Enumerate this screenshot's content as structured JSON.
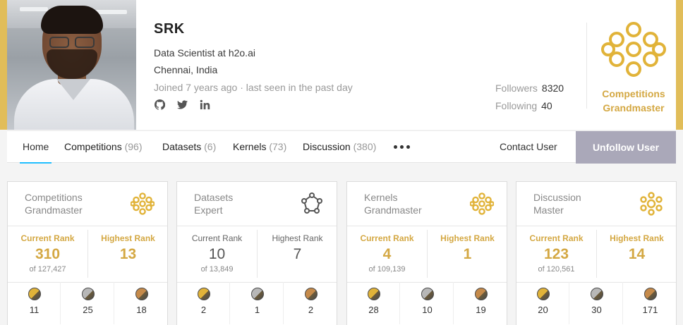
{
  "profile": {
    "name": "SRK",
    "occupation": "Data Scientist at h2o.ai",
    "location": "Chennai, India",
    "joined": "Joined 7 years ago · last seen in the past day",
    "socials": [
      "github-icon",
      "twitter-icon",
      "linkedin-icon"
    ],
    "followers_label": "Followers",
    "followers_count": "8320",
    "following_label": "Following",
    "following_count": "40",
    "tier_line1": "Competitions",
    "tier_line2": "Grandmaster"
  },
  "nav": {
    "home": "Home",
    "competitions": "Competitions",
    "competitions_count": "(96)",
    "datasets": "Datasets",
    "datasets_count": "(6)",
    "kernels": "Kernels",
    "kernels_count": "(73)",
    "discussion": "Discussion",
    "discussion_count": "(380)",
    "contact": "Contact User",
    "unfollow": "Unfollow User"
  },
  "colors": {
    "gold": "#d4a843",
    "accent_blue": "#20beff",
    "unfollow_bg": "#aaa8b9",
    "medal_gold": "#e1b339",
    "medal_silver": "#b8b8b8",
    "medal_bronze": "#c58a4a"
  },
  "cards": [
    {
      "title_line1": "Competitions",
      "title_line2": "Grandmaster",
      "icon": "grandmaster-icon",
      "current_label": "Current Rank",
      "current_value": "310",
      "current_sub": "of 127,427",
      "highest_label": "Highest Rank",
      "highest_value": "13",
      "medals": [
        "11",
        "25",
        "18"
      ]
    },
    {
      "title_line1": "Datasets",
      "title_line2": "Expert",
      "icon": "expert-icon",
      "current_label": "Current Rank",
      "current_value": "10",
      "current_sub": "of 13,849",
      "highest_label": "Highest Rank",
      "highest_value": "7",
      "medals": [
        "2",
        "1",
        "2"
      ]
    },
    {
      "title_line1": "Kernels",
      "title_line2": "Grandmaster",
      "icon": "grandmaster-icon",
      "current_label": "Current Rank",
      "current_value": "4",
      "current_sub": "of 109,139",
      "highest_label": "Highest Rank",
      "highest_value": "1",
      "medals": [
        "28",
        "10",
        "19"
      ]
    },
    {
      "title_line1": "Discussion",
      "title_line2": "Master",
      "icon": "master-icon",
      "current_label": "Current Rank",
      "current_value": "123",
      "current_sub": "of 120,561",
      "highest_label": "Highest Rank",
      "highest_value": "14",
      "medals": [
        "20",
        "30",
        "171"
      ]
    }
  ]
}
